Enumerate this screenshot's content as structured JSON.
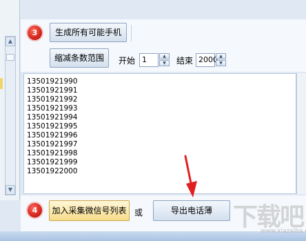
{
  "step3": {
    "badge": "3",
    "generate_button": "生成所有可能手机",
    "narrow_button": "缩减条数范围",
    "start_label": "开始",
    "start_value": "1",
    "end_label": "结束",
    "end_value": "2000"
  },
  "numbers": [
    "13501921990",
    "13501921991",
    "13501921992",
    "13501921993",
    "13501921994",
    "13501921995",
    "13501921996",
    "13501921997",
    "13501921998",
    "13501921999",
    "13501922000"
  ],
  "step4": {
    "badge": "4",
    "add_button": "加入采集微信号列表",
    "or_label": "或",
    "export_button": "导出电话薄"
  },
  "scrollbar": {
    "up_glyph": "▲",
    "down_glyph": "▼"
  },
  "watermark": {
    "text": "下载吧",
    "sub": "www.xiazaiba.com"
  },
  "colors": {
    "badge_red": "#d4241c",
    "annotation_arrow": "#e02020",
    "yellow_button": "#f7dc8a"
  }
}
